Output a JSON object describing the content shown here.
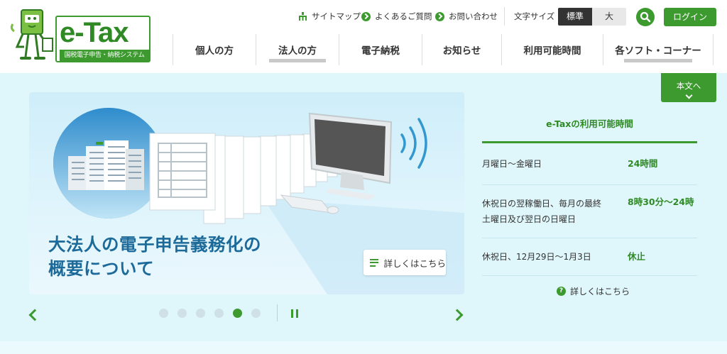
{
  "logo": {
    "text": "e-Tax",
    "subtitle": "国税電子申告・納税システム"
  },
  "utility": {
    "sitemap": "サイトマップ",
    "faq": "よくあるご質問",
    "contact": "お問い合わせ",
    "font_size_label": "文字サイズ",
    "font_std": "標準",
    "font_big": "大",
    "login": "ログイン"
  },
  "nav": [
    {
      "label": "個人の方",
      "active": false
    },
    {
      "label": "法人の方",
      "active": true
    },
    {
      "label": "電子納税",
      "active": false
    },
    {
      "label": "お知らせ",
      "active": false
    },
    {
      "label": "利用可能時間",
      "active": false
    },
    {
      "label": "各ソフト・コーナー",
      "active": true
    }
  ],
  "to_content": "本文へ",
  "banner": {
    "title_line1": "大法人の電子申告義務化の",
    "title_line2": "概要について",
    "more": "詳しくはこちら"
  },
  "carousel": {
    "slides": 6,
    "active_index": 4
  },
  "availability": {
    "title": "e-Taxの利用可能時間",
    "rows": [
      {
        "day": "月曜日～金曜日",
        "time": "24時間"
      },
      {
        "day_line1": "休祝日の翌稼働日、毎月の最終",
        "day_line2": "土曜日及び翌日の日曜日",
        "time": "8時30分～24時"
      },
      {
        "day": "休祝日、12月29日～1月3日",
        "time": "休止"
      }
    ],
    "more": "詳しくはこちら"
  },
  "colors": {
    "brand_green": "#3c9a2f",
    "banner_text": "#1c6a99",
    "main_bg": "#dff6fb"
  }
}
